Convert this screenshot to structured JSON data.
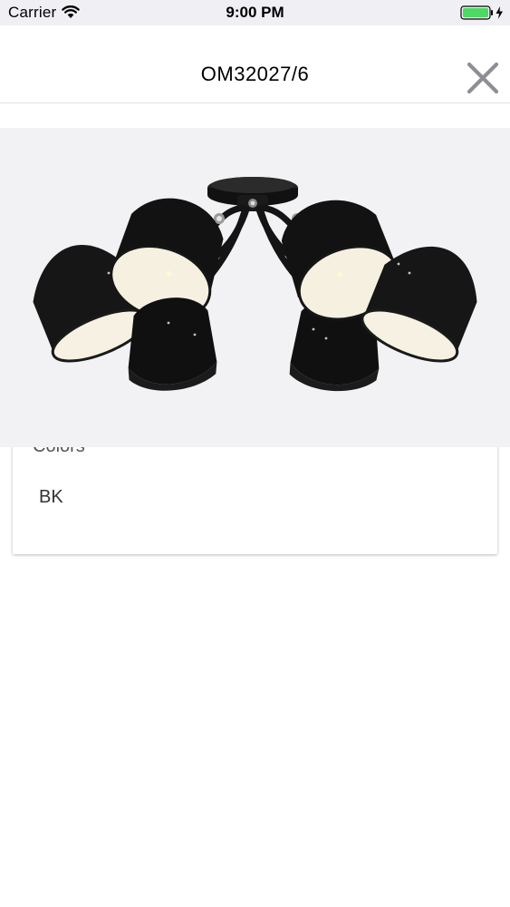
{
  "status_bar": {
    "carrier": "Carrier",
    "time": "9:00 PM",
    "wifi_icon": "wifi-icon",
    "battery_icon": "battery-charging-icon",
    "battery_color": "#4cd964"
  },
  "nav": {
    "title": "OM32027/6",
    "close_icon": "close-icon",
    "close_color": "#8e8e93"
  },
  "product": {
    "image_subject": "black six-arm ceiling chandelier with bell shades"
  },
  "card": {
    "heading": "Colors",
    "value": "BK"
  }
}
